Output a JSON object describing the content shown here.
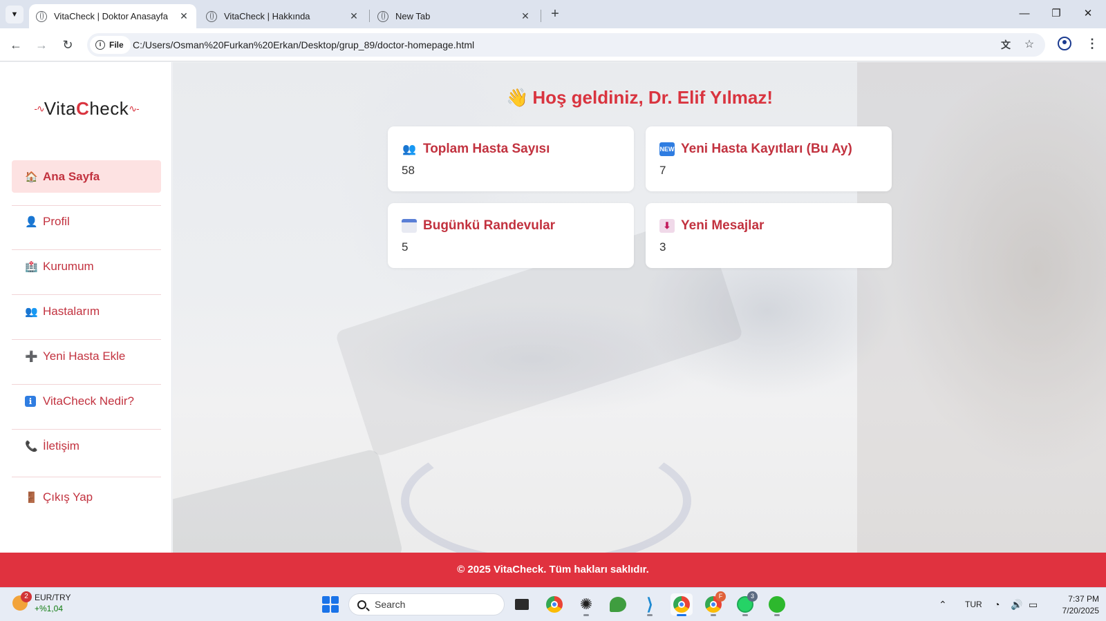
{
  "browser": {
    "tabs": [
      {
        "title": "VitaCheck | Doktor Anasayfa",
        "active": true
      },
      {
        "title": "VitaCheck | Hakkında",
        "active": false
      },
      {
        "title": "New Tab",
        "active": false
      }
    ],
    "file_chip": "File",
    "url": "C:/Users/Osman%20Furkan%20Erkan/Desktop/grup_89/doctor-homepage.html"
  },
  "sidebar": {
    "logo": {
      "prefix": "Vita",
      "accent": "C",
      "suffix": "heck"
    },
    "items": [
      {
        "icon": "🏠",
        "label": "Ana Sayfa",
        "active": true
      },
      {
        "icon": "👤",
        "label": "Profil"
      },
      {
        "icon": "🏥",
        "label": "Kurumum"
      },
      {
        "icon": "👥",
        "label": "Hastalarım"
      },
      {
        "icon": "➕",
        "label": "Yeni Hasta Ekle"
      },
      {
        "icon": "ℹ",
        "label": "VitaCheck Nedir?"
      },
      {
        "icon": "📞",
        "label": "İletişim"
      },
      {
        "icon": "🚪",
        "label": "Çıkış Yap"
      }
    ]
  },
  "main": {
    "welcome_icon": "👋",
    "welcome": "Hoş geldiniz, Dr. Elif Yılmaz!",
    "cards": [
      {
        "icon": "people-icon",
        "title": "Toplam Hasta Sayısı",
        "value": "58"
      },
      {
        "icon": "new-icon",
        "title": "Yeni Hasta Kayıtları (Bu Ay)",
        "value": "7"
      },
      {
        "icon": "calendar-icon",
        "title": "Bugünkü Randevular",
        "value": "5"
      },
      {
        "icon": "inbox-icon",
        "title": "Yeni Mesajlar",
        "value": "3"
      }
    ]
  },
  "footer": "© 2025 VitaCheck. Tüm hakları saklıdır.",
  "taskbar": {
    "widget": {
      "title": "EUR/TRY",
      "change": "+%1,04",
      "badge": "2"
    },
    "search_placeholder": "Search",
    "app_badges": {
      "chrome_profile": "F",
      "whatsapp": "3"
    },
    "language": "TUR",
    "time": "7:37 PM",
    "date": "7/20/2025"
  },
  "colors": {
    "accent": "#d9343f",
    "footer": "#e0323f",
    "active_nav_bg": "#fde2e2"
  }
}
